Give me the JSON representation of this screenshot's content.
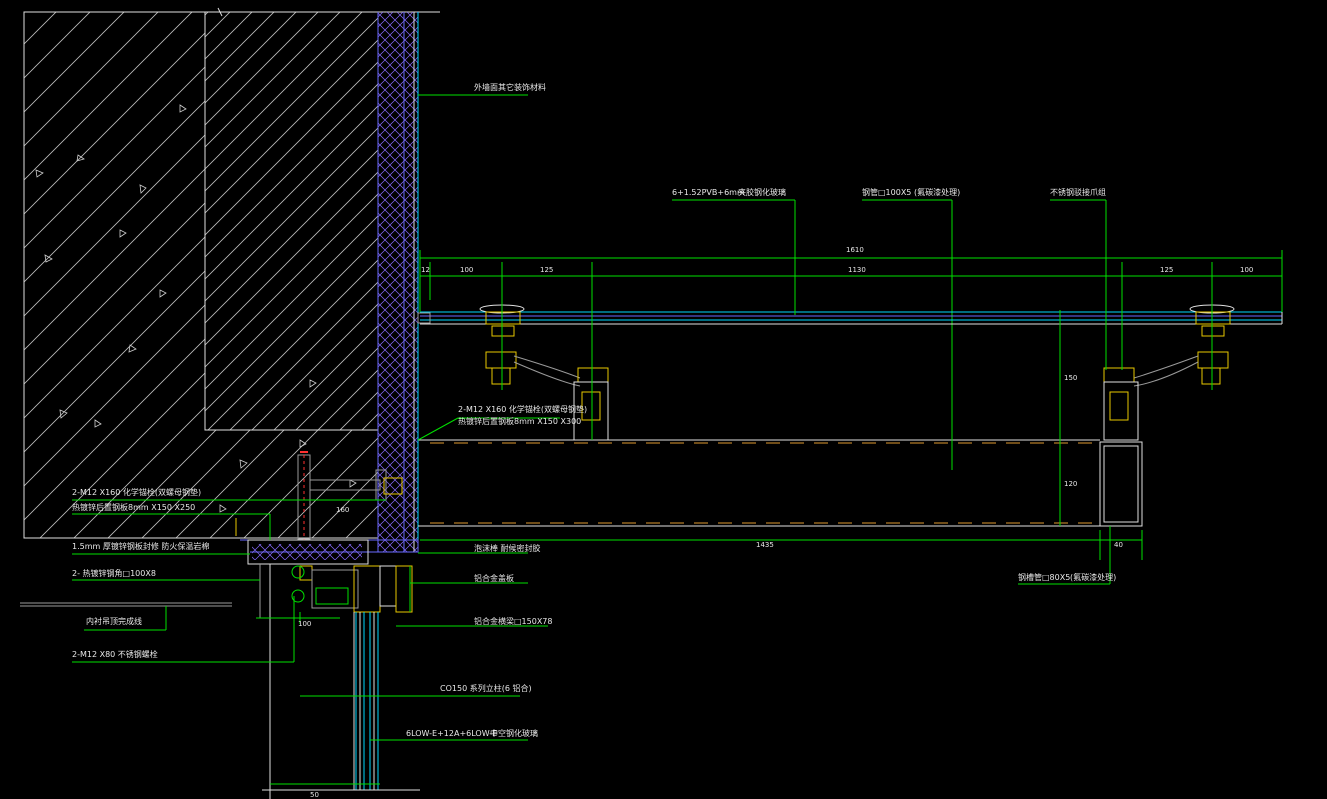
{
  "annotations": {
    "a1": "外墙面其它装饰材料",
    "a2": "6+1.52PVB+6mm",
    "a3": "夹胶钢化玻璃",
    "a4": "钢管□100X5",
    "a5": "(氟碳漆处理)",
    "a6": "不锈钢驳接爪组",
    "a7": "2-M12   X160  化学锚栓(双螺母钢垫)",
    "a8": "热镀锌后置钢板8mm   X150 X300",
    "a9": "2-M12   X160  化学锚栓(双螺母钢垫)",
    "a10": "热镀锌后置钢板8mm  X150 X250",
    "a11": "1.5mm   厚镀锌钢板封修 防火保温岩棉",
    "a12": "2-  热镀锌钢角□100X8",
    "a13": "泡沫棒 耐候密封胶",
    "a14": "铝合金盖板",
    "a15": "铝合金横梁□150X78",
    "a16": "内衬吊顶完成线",
    "a17": "2-M12   X80  不锈钢螺栓",
    "a18": "钢槽管□80X5",
    "a19": "(氟碳漆处理)",
    "a20": "CO150  系列立柱(6 铝合)",
    "a21": "6LOW-E+12A+6LOW-E",
    "a22": "中空钢化玻璃"
  },
  "dims": {
    "d_total": "1610",
    "d12": "12",
    "d100a": "100",
    "d125a": "125",
    "d1130": "1130",
    "d125b": "125",
    "d100b": "100",
    "d_h1": "150",
    "d_h2": "120",
    "d1435": "1435",
    "d40": "40",
    "d160": "160",
    "d_s1": "100",
    "d_s2": "50"
  }
}
